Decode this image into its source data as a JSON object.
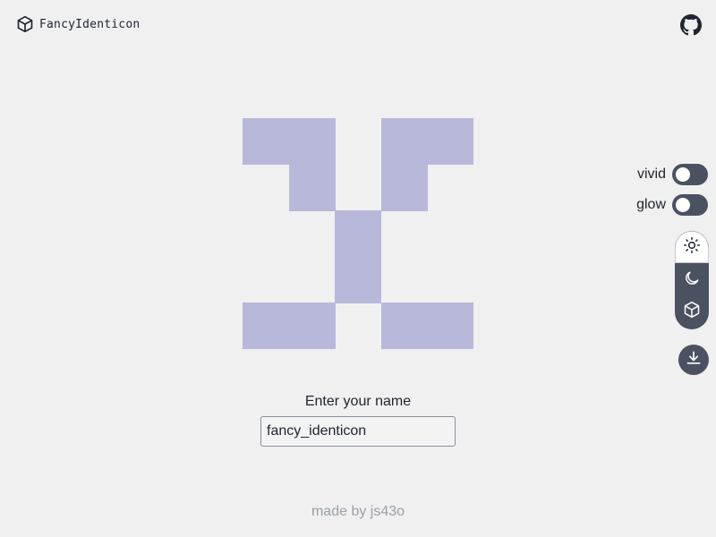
{
  "header": {
    "title": "FancyIdenticon",
    "logo_icon": "cube-icon",
    "github_icon": "github-icon"
  },
  "identicon": {
    "color": "#b8b8da",
    "grid_size": 5,
    "filled_cells": [
      [
        0,
        0
      ],
      [
        0,
        1
      ],
      [
        0,
        3
      ],
      [
        0,
        4
      ],
      [
        1,
        1
      ],
      [
        1,
        3
      ],
      [
        2,
        2
      ],
      [
        3,
        2
      ],
      [
        4,
        0
      ],
      [
        4,
        1
      ],
      [
        4,
        3
      ],
      [
        4,
        4
      ]
    ]
  },
  "form": {
    "label": "Enter your name",
    "input_value": "fancy_identicon"
  },
  "controls": {
    "vivid_label": "vivid",
    "vivid_on": false,
    "glow_label": "glow",
    "glow_on": false,
    "theme_options": [
      {
        "name": "light",
        "icon": "sun-icon",
        "active": true
      },
      {
        "name": "dark",
        "icon": "moon-icon",
        "active": false
      },
      {
        "name": "3d",
        "icon": "cube-icon",
        "active": false
      }
    ],
    "download_icon": "download-icon"
  },
  "footer": {
    "text": "made by js43o"
  },
  "colors": {
    "background": "#f0f0f0",
    "control_dark": "#4a5262",
    "identicon_cell": "#b8b8da",
    "footer_text": "#9aa0aa"
  }
}
